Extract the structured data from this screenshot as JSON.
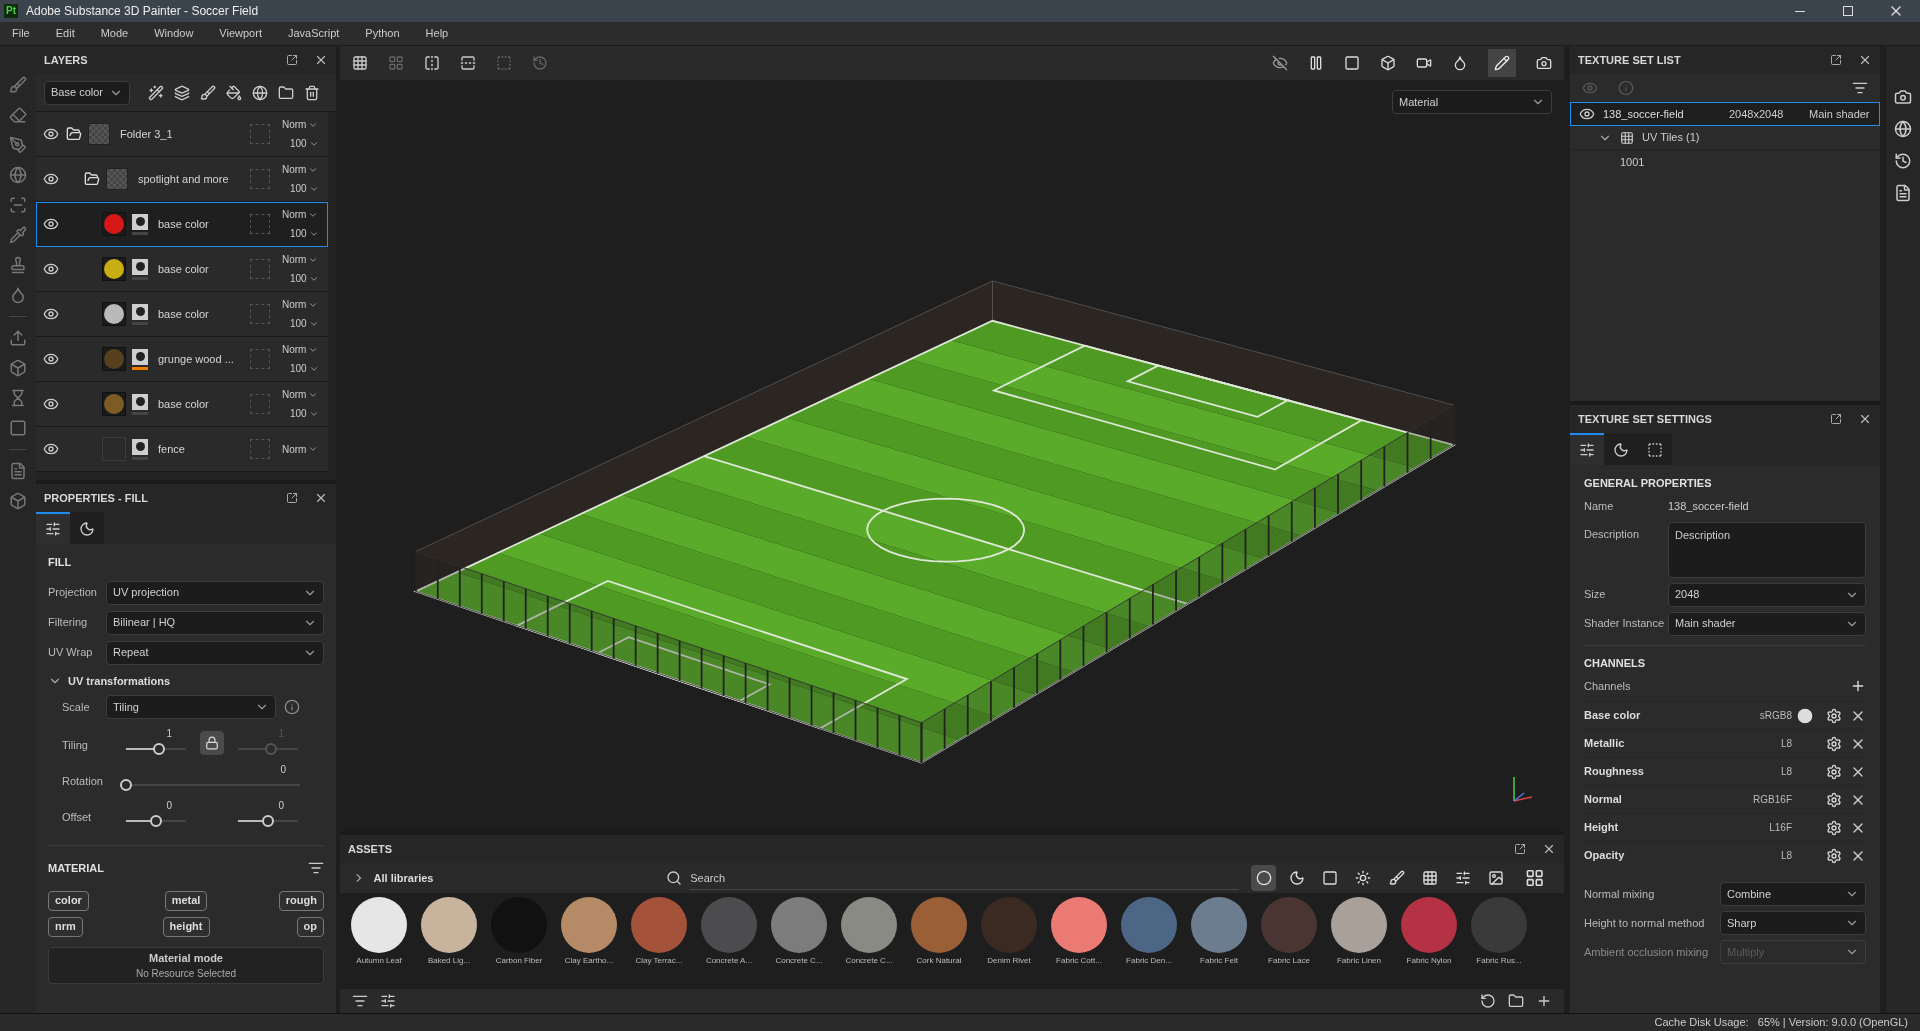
{
  "window": {
    "app_badge": "Pt",
    "title": "Adobe Substance 3D Painter - Soccer Field"
  },
  "menu": [
    "File",
    "Edit",
    "Mode",
    "Window",
    "Viewport",
    "JavaScript",
    "Python",
    "Help"
  ],
  "layers_panel": {
    "title": "LAYERS",
    "channel": "Base color",
    "layers": [
      {
        "name": "Folder 3_1",
        "kind": "folder",
        "blend": "Norm",
        "opacity": "100",
        "visible": true,
        "selected": false,
        "children": [
          {
            "name": "spotlight and more",
            "kind": "folder",
            "blend": "Norm",
            "opacity": "100",
            "visible": true,
            "selected": false,
            "children": [
              {
                "name": "base color",
                "kind": "fill",
                "color": "#d81818",
                "blend": "Norm",
                "opacity": "100",
                "visible": true,
                "selected": true,
                "mask_flag": false
              },
              {
                "name": "base color",
                "kind": "fill",
                "color": "#c9ae12",
                "blend": "Norm",
                "opacity": "100",
                "visible": true,
                "selected": false,
                "mask_flag": false
              },
              {
                "name": "base color",
                "kind": "fill",
                "color": "#b9b9b9",
                "blend": "Norm",
                "opacity": "100",
                "visible": true,
                "selected": false,
                "mask_flag": false
              },
              {
                "name": "grunge wood ...",
                "kind": "fill",
                "color": "#56401f",
                "blend": "Norm",
                "opacity": "100",
                "visible": true,
                "selected": false,
                "mask_flag": true
              },
              {
                "name": "base color",
                "kind": "fill",
                "color": "#7d5b24",
                "blend": "Norm",
                "opacity": "100",
                "visible": true,
                "selected": false,
                "mask_flag": false
              },
              {
                "name": "fence",
                "kind": "fill",
                "blend": "Norm",
                "visible": true,
                "selected": false,
                "mask_flag": false
              }
            ]
          }
        ]
      }
    ]
  },
  "properties": {
    "title": "PROPERTIES - FILL",
    "tabs": [
      {
        "selected": true
      },
      {
        "selected": false
      }
    ],
    "section": "FILL",
    "fields": [
      {
        "label": "Projection",
        "value": "UV projection"
      },
      {
        "label": "Filtering",
        "value": "Bilinear | HQ"
      },
      {
        "label": "UV Wrap",
        "value": "Repeat"
      }
    ],
    "uv_transformations": {
      "title": "UV transformations",
      "expanded": true,
      "scale": {
        "label": "Scale",
        "value": "Tiling"
      },
      "sliders": [
        {
          "label": "Tiling",
          "locked": true,
          "thumbs": [
            {
              "reading": "1",
              "level": 0.55,
              "disabled": false
            },
            {
              "reading": "1",
              "level": 0.55,
              "disabled": true
            }
          ]
        },
        {
          "label": "Rotation",
          "thumbs": [
            {
              "reading": "0",
              "level": 0,
              "disabled": false
            }
          ]
        },
        {
          "label": "Offset",
          "thumbs": [
            {
              "reading": "0",
              "level": 0.5,
              "disabled": false
            },
            {
              "reading": "0",
              "level": 0.5,
              "disabled": false
            }
          ]
        }
      ]
    },
    "material": {
      "title": "MATERIAL",
      "buttons": [
        "color",
        "metal",
        "rough",
        "nrm",
        "height",
        "op"
      ],
      "mode_title": "Material mode",
      "mode_status": "No Resource Selected"
    }
  },
  "viewport": {
    "mode": "Material"
  },
  "assets": {
    "title": "ASSETS",
    "library": "All libraries",
    "search": {
      "placeholder": "Search"
    },
    "filters": [
      {
        "selected": true
      },
      {
        "selected": false
      },
      {
        "selected": false
      },
      {
        "selected": false
      },
      {
        "selected": false
      },
      {
        "selected": false
      },
      {
        "selected": false
      },
      {
        "selected": false
      }
    ],
    "items": [
      {
        "name": "Autumn Leaf",
        "color": "#e6e6e6"
      },
      {
        "name": "Baked Lig...",
        "color": "#c8b49c"
      },
      {
        "name": "Carbon Fiber",
        "color": "#111111"
      },
      {
        "name": "Clay Eartho...",
        "color": "#b58a66"
      },
      {
        "name": "Clay Terrac...",
        "color": "#a4523a"
      },
      {
        "name": "Concrete A...",
        "color": "#4c4c4f"
      },
      {
        "name": "Concrete C...",
        "color": "#7c7c7c"
      },
      {
        "name": "Concrete C...",
        "color": "#8a8a84"
      },
      {
        "name": "Cork Natural",
        "color": "#9b5f38"
      },
      {
        "name": "Denim Rivet",
        "color": "#3a2a22"
      },
      {
        "name": "Fabric Cott...",
        "color": "#ec7a74"
      },
      {
        "name": "Fabric Den...",
        "color": "#4d6686"
      },
      {
        "name": "Fabric Felt",
        "color": "#6d7d90"
      },
      {
        "name": "Fabric Lace",
        "color": "#4a3533"
      },
      {
        "name": "Fabric Linen",
        "color": "#a8a099"
      },
      {
        "name": "Fabric Nylon",
        "color": "#b53244"
      },
      {
        "name": "Fabric Rus...",
        "color": "#3a3a3a"
      }
    ]
  },
  "texture_set_list": {
    "title": "TEXTURE SET LIST",
    "sets": [
      {
        "name": "138_soccer-field",
        "size": "2048x2048",
        "shader": "Main shader",
        "selected": true,
        "visible": true,
        "uv_tiles": {
          "label": "UV Tiles (1)",
          "expanded": true,
          "tiles": [
            "1001"
          ]
        }
      }
    ]
  },
  "texture_set_settings": {
    "title": "TEXTURE SET SETTINGS",
    "tabs": [
      {
        "selected": true
      },
      {
        "selected": false
      },
      {
        "selected": false
      }
    ],
    "general_title": "GENERAL PROPERTIES",
    "name_label": "Name",
    "name_value": "138_soccer-field",
    "description_label": "Description",
    "description": {
      "placeholder": "Description"
    },
    "size": {
      "label": "Size",
      "value": "2048"
    },
    "shader_instance": {
      "label": "Shader Instance",
      "value": "Main shader"
    },
    "channels_title": "CHANNELS",
    "channels_label": "Channels",
    "channels": [
      {
        "name": "Base color",
        "format": "sRGB8",
        "color_space_icon": true
      },
      {
        "name": "Metallic",
        "format": "L8",
        "color_space_icon": false
      },
      {
        "name": "Roughness",
        "format": "L8",
        "color_space_icon": false
      },
      {
        "name": "Normal",
        "format": "RGB16F",
        "color_space_icon": false
      },
      {
        "name": "Height",
        "format": "L16F",
        "color_space_icon": false
      },
      {
        "name": "Opacity",
        "format": "L8",
        "color_space_icon": false
      }
    ],
    "mixing": [
      {
        "label": "Normal mixing",
        "value": "Combine",
        "disabled": false
      },
      {
        "label": "Height to normal method",
        "value": "Sharp",
        "disabled": false
      },
      {
        "label": "Ambient occlusion mixing",
        "value": "Multiply",
        "disabled": true
      }
    ]
  },
  "status_bar": "Cache Disk Usage:   65% | Version: 9.0.0 (OpenGL)"
}
